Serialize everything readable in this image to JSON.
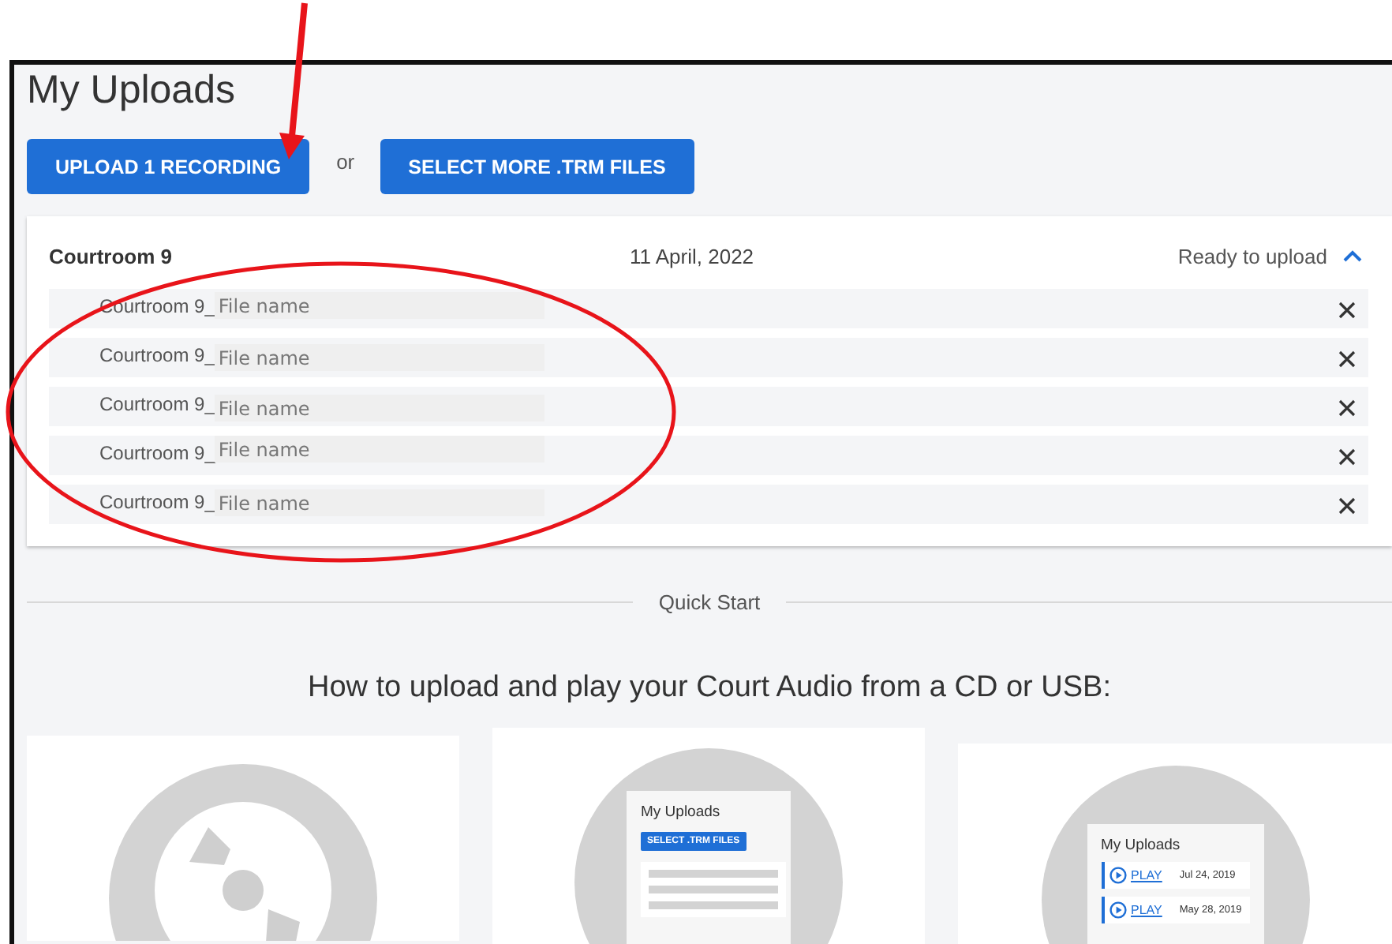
{
  "page": {
    "title": "My Uploads"
  },
  "actions": [
    {
      "label": "UPLOAD 1 RECORDING",
      "kind": "primary"
    },
    {
      "label": "or",
      "kind": "separator"
    },
    {
      "label": "SELECT MORE .TRM FILES",
      "kind": "primary"
    }
  ],
  "upload_group": {
    "name": "Courtroom 9",
    "date": "11 April, 2022",
    "status": "Ready to upload",
    "expanded": true,
    "files": [
      {
        "prefix": "Courtroom 9_",
        "placeholder": "File name"
      },
      {
        "prefix": "Courtroom 9_",
        "placeholder": "File name"
      },
      {
        "prefix": "Courtroom 9_",
        "placeholder": "File name"
      },
      {
        "prefix": "Courtroom 9_",
        "placeholder": "File name"
      },
      {
        "prefix": "Courtroom 9_",
        "placeholder": "File name"
      }
    ]
  },
  "quick_start": {
    "divider_label": "Quick Start",
    "heading": "How to upload and play your Court Audio from a CD or USB:",
    "cards": [
      {
        "kind": "disc"
      },
      {
        "kind": "select",
        "panel_title": "My Uploads",
        "button": "SELECT .TRM FILES"
      },
      {
        "kind": "play",
        "panel_title": "My Uploads",
        "entries": [
          {
            "link": "PLAY",
            "date": "Jul 24, 2019"
          },
          {
            "link": "PLAY",
            "date": "May 28, 2019"
          }
        ]
      }
    ]
  }
}
